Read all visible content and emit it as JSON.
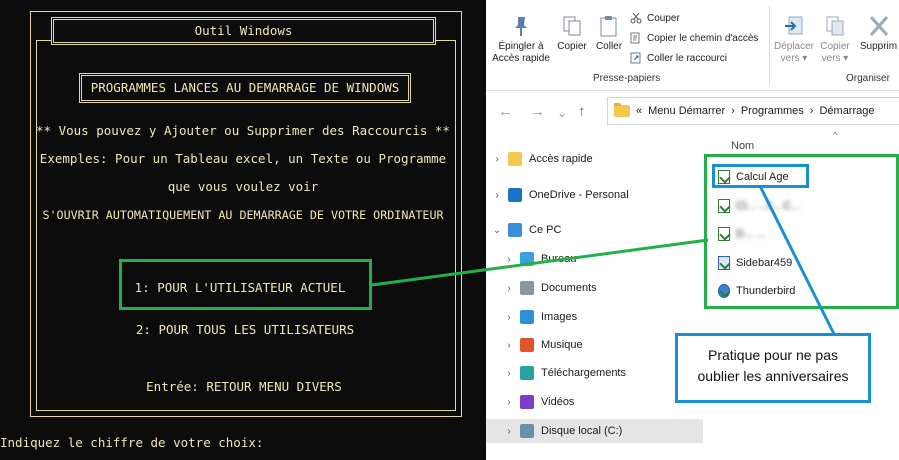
{
  "console": {
    "title": "Outil Windows",
    "heading": "PROGRAMMES LANCES AU DEMARRAGE DE WINDOWS",
    "lines": [
      "** Vous pouvez y Ajouter ou Supprimer des Raccourcis **",
      "Exemples: Pour un Tableau excel, un Texte ou Programme",
      "que vous voulez voir",
      "S'OUVRIR AUTOMATIQUEMENT AU DEMARRAGE DE VOTRE ORDINATEUR"
    ],
    "options": [
      "1: POUR L'UTILISATEUR ACTUEL",
      "2: POUR TOUS LES UTILISATEURS"
    ],
    "enter_option": "Entrée:  RETOUR MENU DIVERS",
    "prompt": "Indiquez le chiffre de votre choix:",
    "text_color": "#f0e6b8",
    "background": "#0c0c0c"
  },
  "explorer": {
    "ribbon": {
      "pin_label": "Épingler à\nAccès rapide",
      "copy_label": "Copier",
      "paste_label": "Coller",
      "cut_label": "Couper",
      "copy_path_label": "Copier le chemin d'accès",
      "paste_shortcut_label": "Coller le raccourci",
      "clipboard_group": "Presse-papiers",
      "move_to_label": "Déplacer\nvers ▾",
      "copy_to_label": "Copier\nvers ▾",
      "delete_label": "Supprim",
      "organize_group": "Organiser"
    },
    "address": {
      "prefix": "«",
      "segments": [
        "Menu Démarrer",
        "Programmes",
        "Démarrage"
      ],
      "separator": "›"
    },
    "column_header": "Nom",
    "nav_items": [
      {
        "label": "Accès rapide",
        "icon": "star-icon",
        "color": "#f2c94c"
      },
      {
        "label": "OneDrive - Personal",
        "icon": "cloud-icon",
        "color": "#1a73c9"
      },
      {
        "label": "Ce PC",
        "icon": "computer-icon",
        "color": "#3a8fd8"
      },
      {
        "label": "Bureau",
        "icon": "desktop-icon",
        "color": "#3aa0e0"
      },
      {
        "label": "Documents",
        "icon": "documents-icon",
        "color": "#8a96a8"
      },
      {
        "label": "Images",
        "icon": "images-icon",
        "color": "#2f8fd8"
      },
      {
        "label": "Musique",
        "icon": "music-icon",
        "color": "#e0542a"
      },
      {
        "label": "Téléchargements",
        "icon": "download-icon",
        "color": "#2aa0a0"
      },
      {
        "label": "Vidéos",
        "icon": "videos-icon",
        "color": "#7a3fc8"
      },
      {
        "label": "Disque local (C:)",
        "icon": "drive-icon",
        "color": "#6a8fa8"
      }
    ],
    "files": [
      {
        "label": "Calcul Age",
        "icon": "shortcut-icon",
        "blurred": false
      },
      {
        "label": "Cl... ...f... C...",
        "icon": "shortcut-icon",
        "blurred": true
      },
      {
        "label": "D... ...",
        "icon": "shortcut-icon",
        "blurred": true
      },
      {
        "label": "Sidebar459",
        "icon": "sidebar-app-icon",
        "blurred": false
      },
      {
        "label": "Thunderbird",
        "icon": "thunderbird-icon",
        "blurred": false
      }
    ]
  },
  "callout": {
    "line1": "Pratique pour ne pas",
    "line2": "oublier les anniversaires",
    "border_color": "#1a8fd6"
  },
  "highlight": {
    "green": "#23b04a",
    "blue": "#1a8fd6"
  }
}
